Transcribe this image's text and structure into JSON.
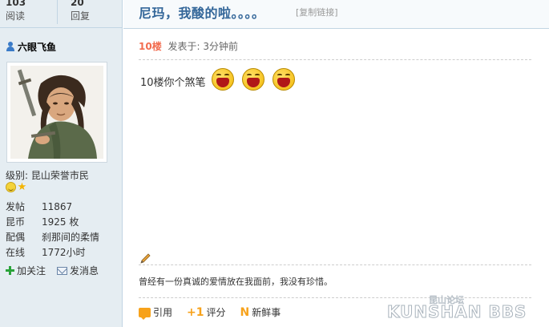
{
  "stats": {
    "views_count": "103",
    "views_label": "阅读",
    "replies_count": "20",
    "replies_label": "回复"
  },
  "thread": {
    "title": "尼玛，我酸的啦。。。。",
    "copy_link": "[复制链接]"
  },
  "author": {
    "name": "六眼飞鱼",
    "level": "级别: 昆山荣誉市民",
    "info": [
      {
        "key": "发帖",
        "value": "11867"
      },
      {
        "key": "昆币",
        "value": "1925 枚"
      },
      {
        "key": "配偶",
        "value": "刹那间的柔情"
      },
      {
        "key": "在线",
        "value": "1772小时"
      }
    ],
    "follow_label": "加关注",
    "message_label": "发消息"
  },
  "post": {
    "floor": "10楼",
    "posted": "发表于: 3分钟前",
    "text": "10楼你个煞笔",
    "emoticon_icons": [
      "laugh-icon",
      "laugh-icon",
      "laugh-icon"
    ],
    "signature": "曾经有一份真诚的爱情放在我面前，我没有珍惜。",
    "actions": {
      "quote": "引用",
      "rate": "评分",
      "fresh": "新鲜事"
    }
  },
  "watermark": {
    "text": "KUNSHAN BBS",
    "small": "昆山论坛"
  },
  "colors": {
    "sidebar_bg": "#e5edf2",
    "title": "#336699",
    "floor": "#f26c4f",
    "accent_orange": "#f7a21b"
  }
}
